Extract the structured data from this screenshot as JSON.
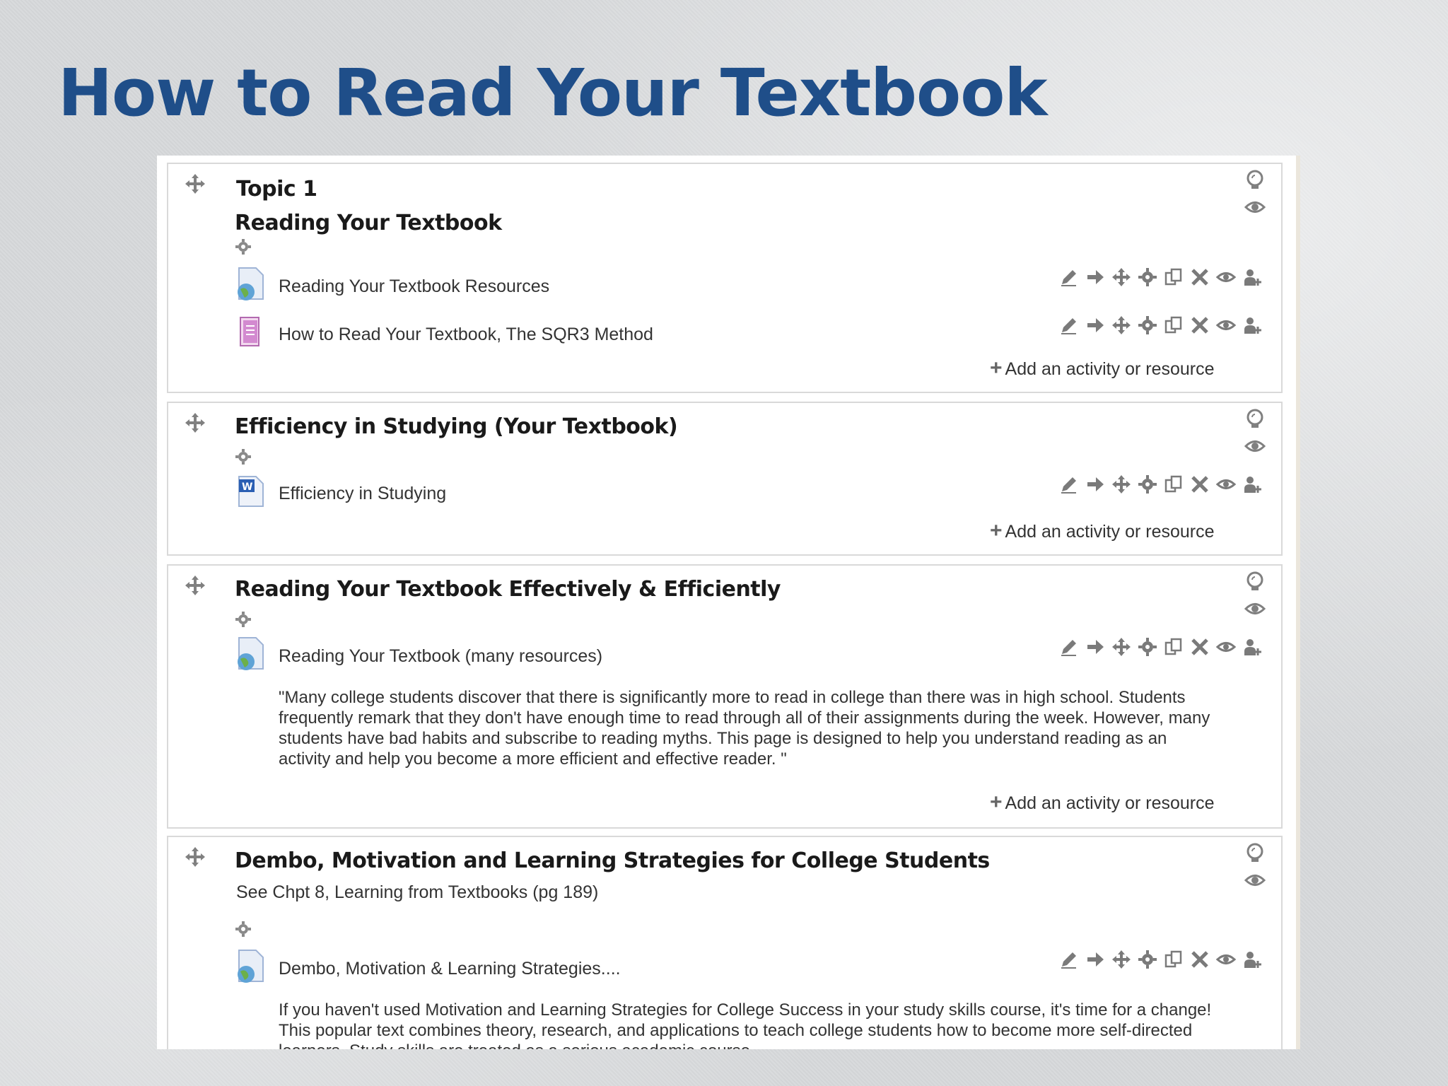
{
  "slide": {
    "title": "How to Read Your Textbook"
  },
  "sections": [
    {
      "topic_label": "Topic 1",
      "title": "Reading Your Textbook",
      "activities": [
        {
          "name": "Reading Your Textbook Resources",
          "icon": "url-globe-icon"
        },
        {
          "name": "How to Read Your Textbook, The SQR3 Method",
          "icon": "book-icon"
        }
      ],
      "add_label": "Add an activity or resource"
    },
    {
      "title": "Efficiency in Studying (Your Textbook)",
      "activities": [
        {
          "name": "Efficiency in Studying",
          "icon": "word-document-icon"
        }
      ],
      "add_label": "Add an activity or resource"
    },
    {
      "title": "Reading Your Textbook Effectively & Efficiently",
      "activities": [
        {
          "name": "Reading Your Textbook (many resources)",
          "icon": "url-globe-icon",
          "description": "\"Many college students discover that there is significantly more to read in college than there was in high school. Students frequently remark that they don't have enough time to read through all of their assignments during the week. However, many students have bad habits and subscribe to reading myths. This page is designed to help you understand reading as an activity and help you become a more efficient and effective reader. \""
        }
      ],
      "add_label": "Add an activity or resource"
    },
    {
      "title": "Dembo, Motivation and Learning Strategies for College Students",
      "subtitle": "See Chpt 8, Learning from Textbooks (pg 189)",
      "activities": [
        {
          "name": "Dembo, Motivation & Learning Strategies....",
          "icon": "url-globe-icon",
          "description": "If you haven't used Motivation and Learning Strategies for College Success in your study skills course, it's time for a change! This popular text combines theory, research, and applications to teach college students how to become more self-directed learners. Study skills are treated as a serious academic course."
        }
      ]
    }
  ],
  "toolbar_icons": [
    "edit-icon",
    "move-right-icon",
    "move-icon",
    "roles-gear-icon",
    "duplicate-icon",
    "delete-icon",
    "hide-eye-icon",
    "assign-roles-icon"
  ],
  "section_side_icons": [
    "highlight-lightbulb-icon",
    "hide-eye-icon"
  ],
  "colors": {
    "title": "#1f4e89",
    "icon_gray": "#7a7a7a"
  }
}
